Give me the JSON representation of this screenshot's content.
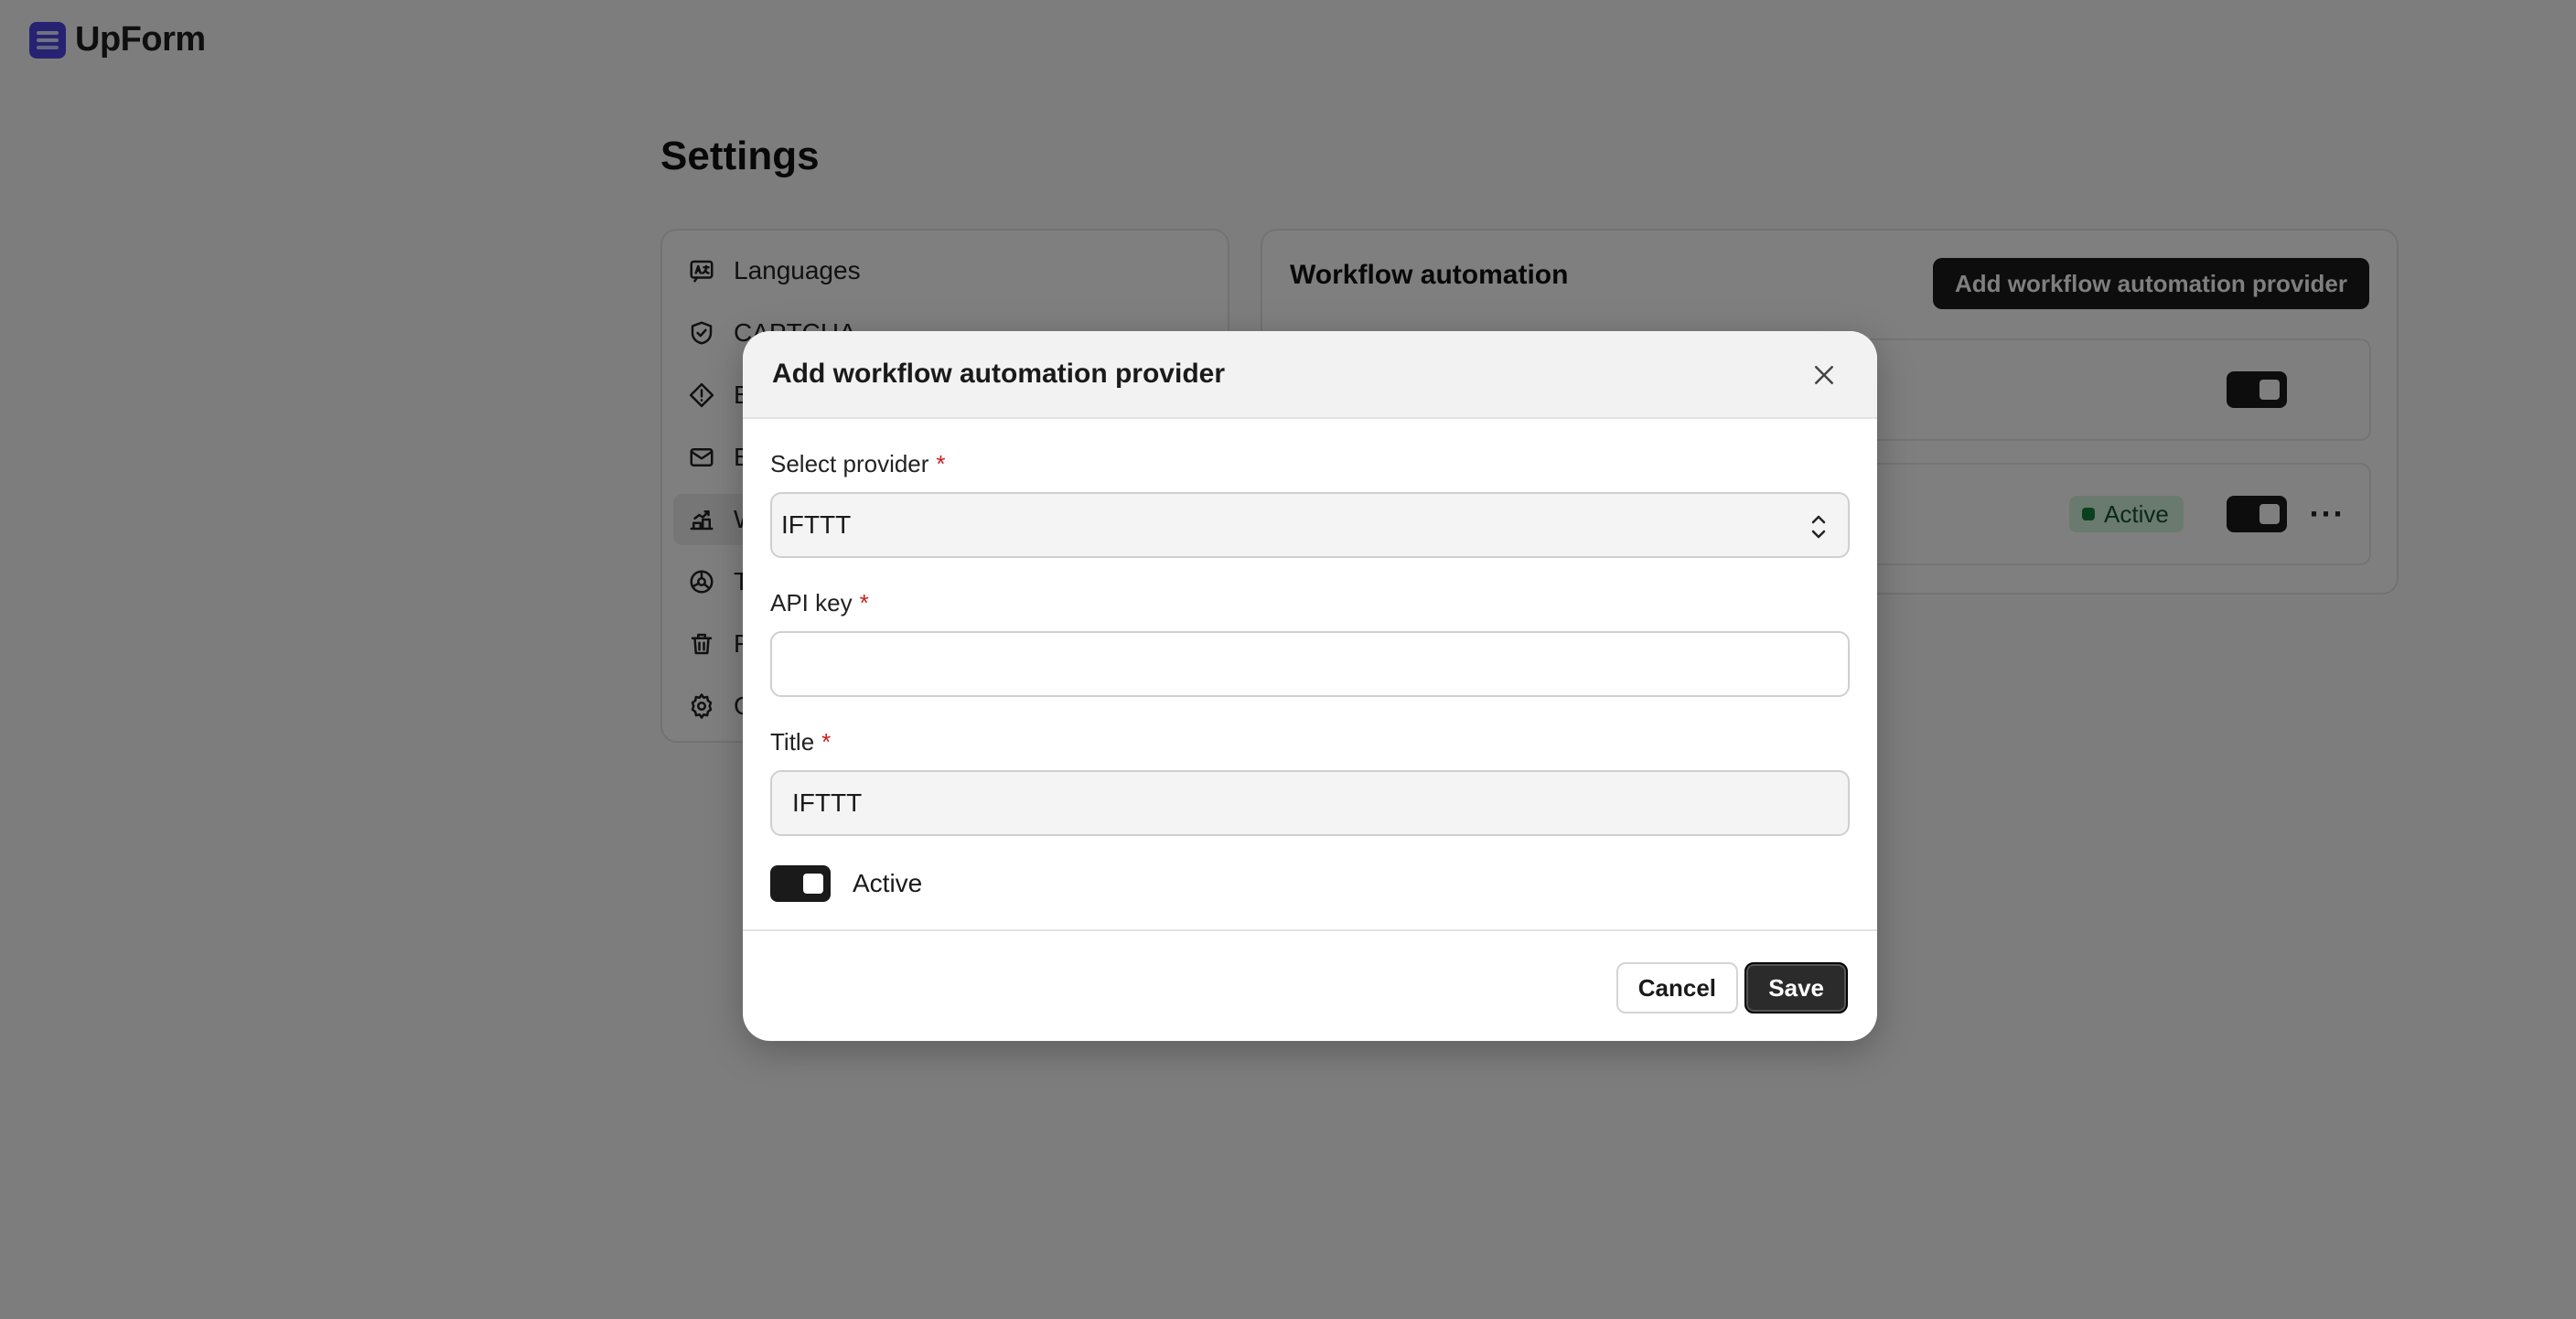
{
  "app": {
    "name": "UpForm"
  },
  "page": {
    "title": "Settings"
  },
  "sidebar": {
    "items": [
      {
        "label": "Languages",
        "icon": "languages-icon"
      },
      {
        "label": "CAPTCHA",
        "icon": "shield-check-icon"
      },
      {
        "label": "E",
        "icon": "alert-diamond-icon"
      },
      {
        "label": "E",
        "icon": "mail-icon"
      },
      {
        "label": "W",
        "icon": "workflow-icon",
        "active": true
      },
      {
        "label": "T",
        "icon": "palette-icon"
      },
      {
        "label": "F",
        "icon": "trash-icon"
      },
      {
        "label": "G",
        "icon": "gear-icon"
      }
    ]
  },
  "main": {
    "title": "Workflow automation",
    "add_button": "Add workflow automation provider",
    "rows": [
      {
        "status": ""
      },
      {
        "status": "Active"
      }
    ]
  },
  "modal": {
    "title": "Add workflow automation provider",
    "provider_label": "Select provider",
    "provider_value": "IFTTT",
    "api_key_label": "API key",
    "api_key_value": "",
    "title_label": "Title",
    "title_value": "IFTTT",
    "required_mark": "*",
    "active_label": "Active",
    "cancel_label": "Cancel",
    "save_label": "Save"
  },
  "colors": {
    "brand": "#4f46e5",
    "primary_button": "#1a1a1a",
    "status_bg": "#d7f5dc",
    "status_dot": "#15803d",
    "required": "#c81e1e"
  }
}
